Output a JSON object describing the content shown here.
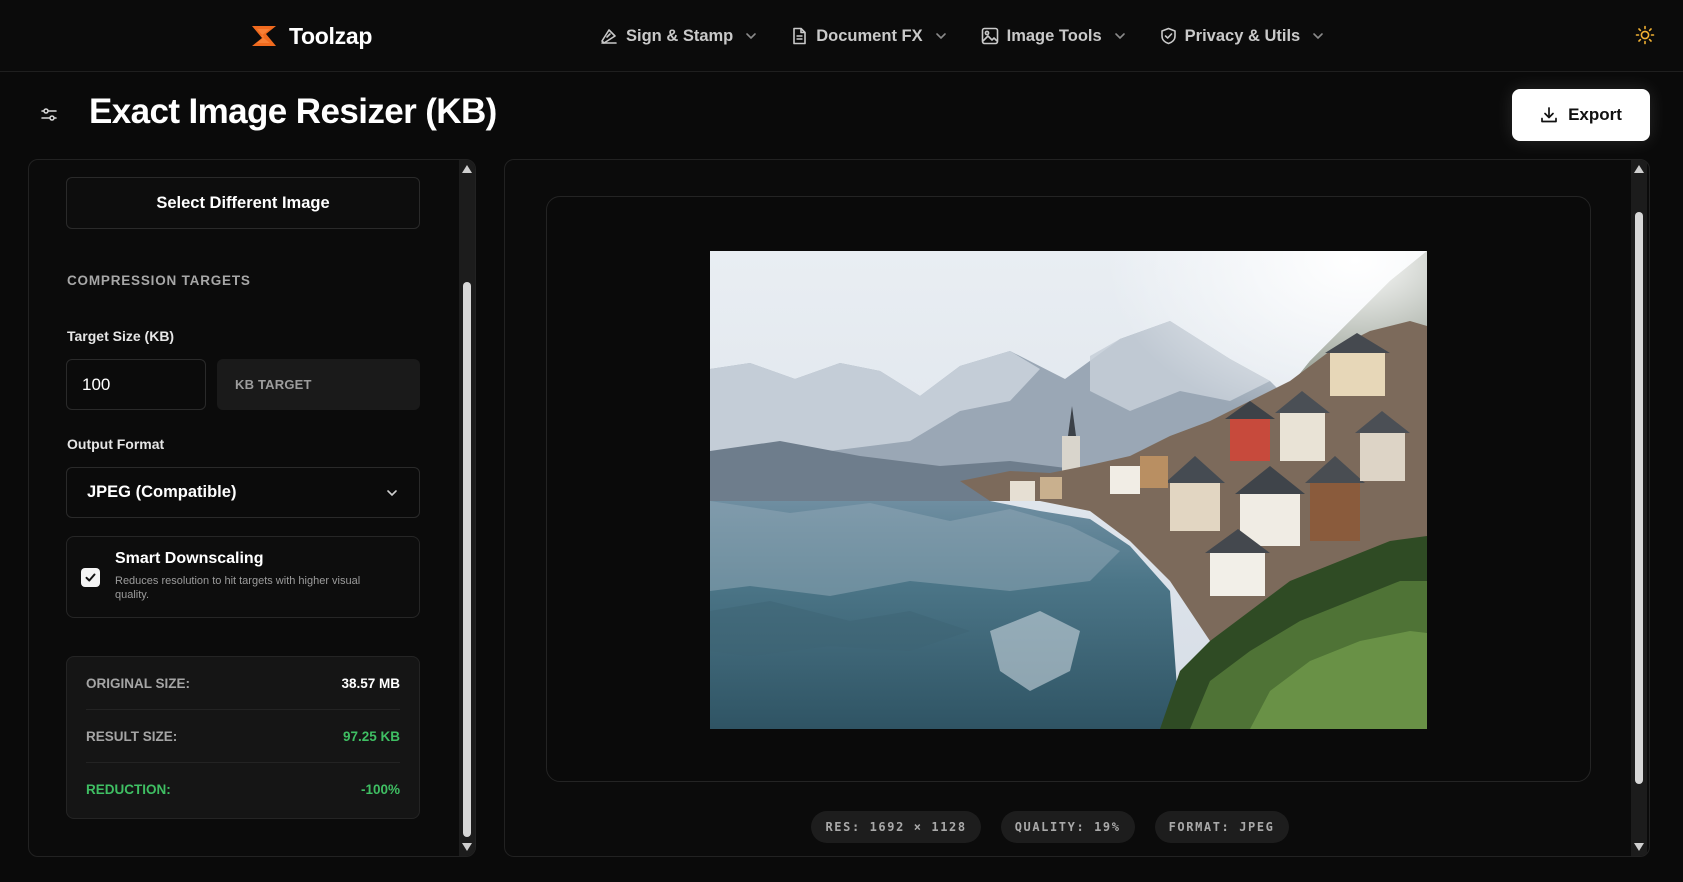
{
  "brand": {
    "name": "Toolzap",
    "accent": "#f06a1e"
  },
  "nav": [
    {
      "label": "Sign & Stamp",
      "icon": "signature-icon"
    },
    {
      "label": "Document FX",
      "icon": "document-icon"
    },
    {
      "label": "Image Tools",
      "icon": "image-icon"
    },
    {
      "label": "Privacy & Utils",
      "icon": "shield-icon"
    }
  ],
  "theme_toggle_icon": "sun-icon",
  "page": {
    "title": "Exact Image Resizer (KB)",
    "export_label": "Export"
  },
  "left": {
    "select_button": "Select Different Image",
    "section_heading": "COMPRESSION TARGETS",
    "target_label": "Target Size (KB)",
    "target_value": "100",
    "target_unit": "KB TARGET",
    "format_label": "Output Format",
    "format_value": "JPEG (Compatible)",
    "smart": {
      "checked": true,
      "title": "Smart Downscaling",
      "description": "Reduces resolution to hit targets with higher visual quality."
    },
    "stats": [
      {
        "label": "ORIGINAL SIZE:",
        "value": "38.57 MB"
      },
      {
        "label": "RESULT SIZE:",
        "value": "97.25 KB"
      },
      {
        "label": "REDUCTION:",
        "value": "-100%"
      }
    ]
  },
  "preview": {
    "badges": [
      "RES: 1692 × 1128",
      "QUALITY: 19%",
      "FORMAT: JPEG"
    ]
  },
  "colors": {
    "success": "#3fbf63",
    "background": "#0a0a0a"
  }
}
